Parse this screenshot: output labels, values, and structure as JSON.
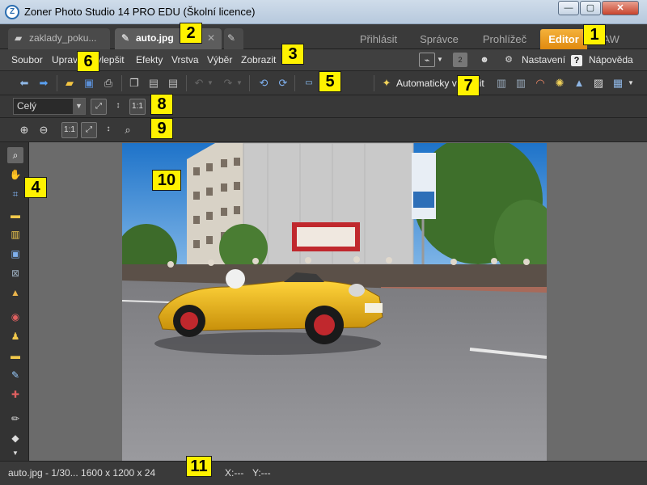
{
  "window": {
    "title": "Zoner Photo Studio 14 PRO EDU (Školní licence)",
    "minimize": "—",
    "maximize": "▢",
    "close": "✕"
  },
  "tabs": {
    "docs": [
      {
        "label": "zaklady_poku..."
      },
      {
        "label": "auto.jpg",
        "close": "✕"
      }
    ],
    "modes": [
      "Přihlásit",
      "Správce",
      "Prohlížeč",
      "Editor",
      "RAW"
    ],
    "active_mode": "Editor"
  },
  "menu": {
    "items": [
      "Soubor",
      "Upravit",
      "Vylepšit",
      "Efekty",
      "Vrstva",
      "Výběr",
      "Zobrazit"
    ],
    "settings": "Nastavení",
    "help": "Nápověda",
    "help_badge": "?",
    "layer_badge": "2"
  },
  "toolbar": {
    "auto_enhance": "Automaticky vylepšit"
  },
  "zoom_bar": {
    "mode": "Celý",
    "one_to_one": "1:1"
  },
  "view_bar": {
    "one_to_one": "1:1"
  },
  "status": {
    "file_info": "auto.jpg - 1/30... 1600 x 1200 x 24",
    "x": "X:---",
    "y": "Y:---"
  },
  "callouts": [
    "1",
    "2",
    "3",
    "4",
    "5",
    "6",
    "7",
    "8",
    "9",
    "10",
    "11"
  ],
  "colors": {
    "accent": "#f0a020",
    "callout": "#fff200",
    "panel": "#3a3a3a"
  }
}
